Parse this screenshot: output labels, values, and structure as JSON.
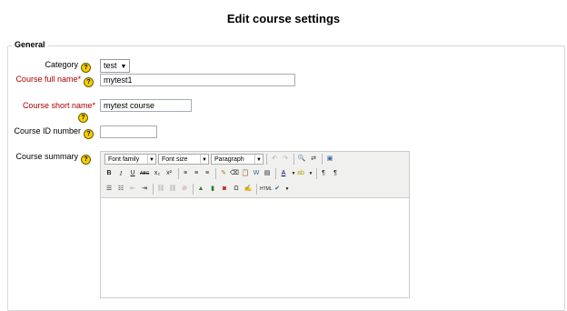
{
  "page": {
    "title": "Edit course settings"
  },
  "section": {
    "legend": "General"
  },
  "form": {
    "category": {
      "label": "Category",
      "value": "test"
    },
    "fullname": {
      "label": "Course full name",
      "value": "mytest1"
    },
    "shortname": {
      "label": "Course short name",
      "value": "mytest course"
    },
    "idnumber": {
      "label": "Course ID number",
      "value": ""
    },
    "summary": {
      "label": "Course summary"
    },
    "required_mark": "*",
    "help_glyph": "?"
  },
  "editor": {
    "font_family": "Font family",
    "font_size": "Font size",
    "format": "Paragraph",
    "buttons": {
      "bold": "B",
      "italic": "I",
      "underline": "U",
      "strike": "ABC",
      "subscript": "x₂",
      "superscript": "x²",
      "html": "HTML"
    }
  },
  "colors": {
    "required": "#aa0000",
    "help": "#f5d000"
  }
}
